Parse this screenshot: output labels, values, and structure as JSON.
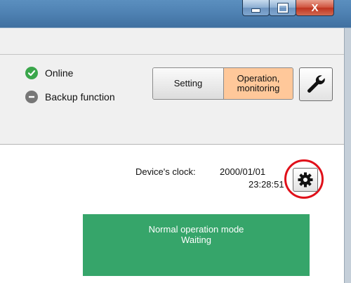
{
  "window": {
    "controls": {
      "minimize_icon": "minimize-icon",
      "maximize_icon": "maximize-icon",
      "close_label": "X"
    }
  },
  "status": {
    "online_label": "Online",
    "online_color": "#3aa64b",
    "backup_label": "Backup function",
    "backup_color": "#777777"
  },
  "mode_toggle": {
    "setting_label": "Setting",
    "operation_line1": "Operation,",
    "operation_line2": "monitoring",
    "active": "operation",
    "active_color": "#ffc89a"
  },
  "tools_icon": "wrench-icon",
  "clock": {
    "label": "Device's clock:",
    "date": "2000/01/01",
    "time": "23:28:51",
    "settings_icon": "gear-icon"
  },
  "operation_status": {
    "line1": "Normal operation mode",
    "line2": "Waiting",
    "color": "#36a56a"
  }
}
